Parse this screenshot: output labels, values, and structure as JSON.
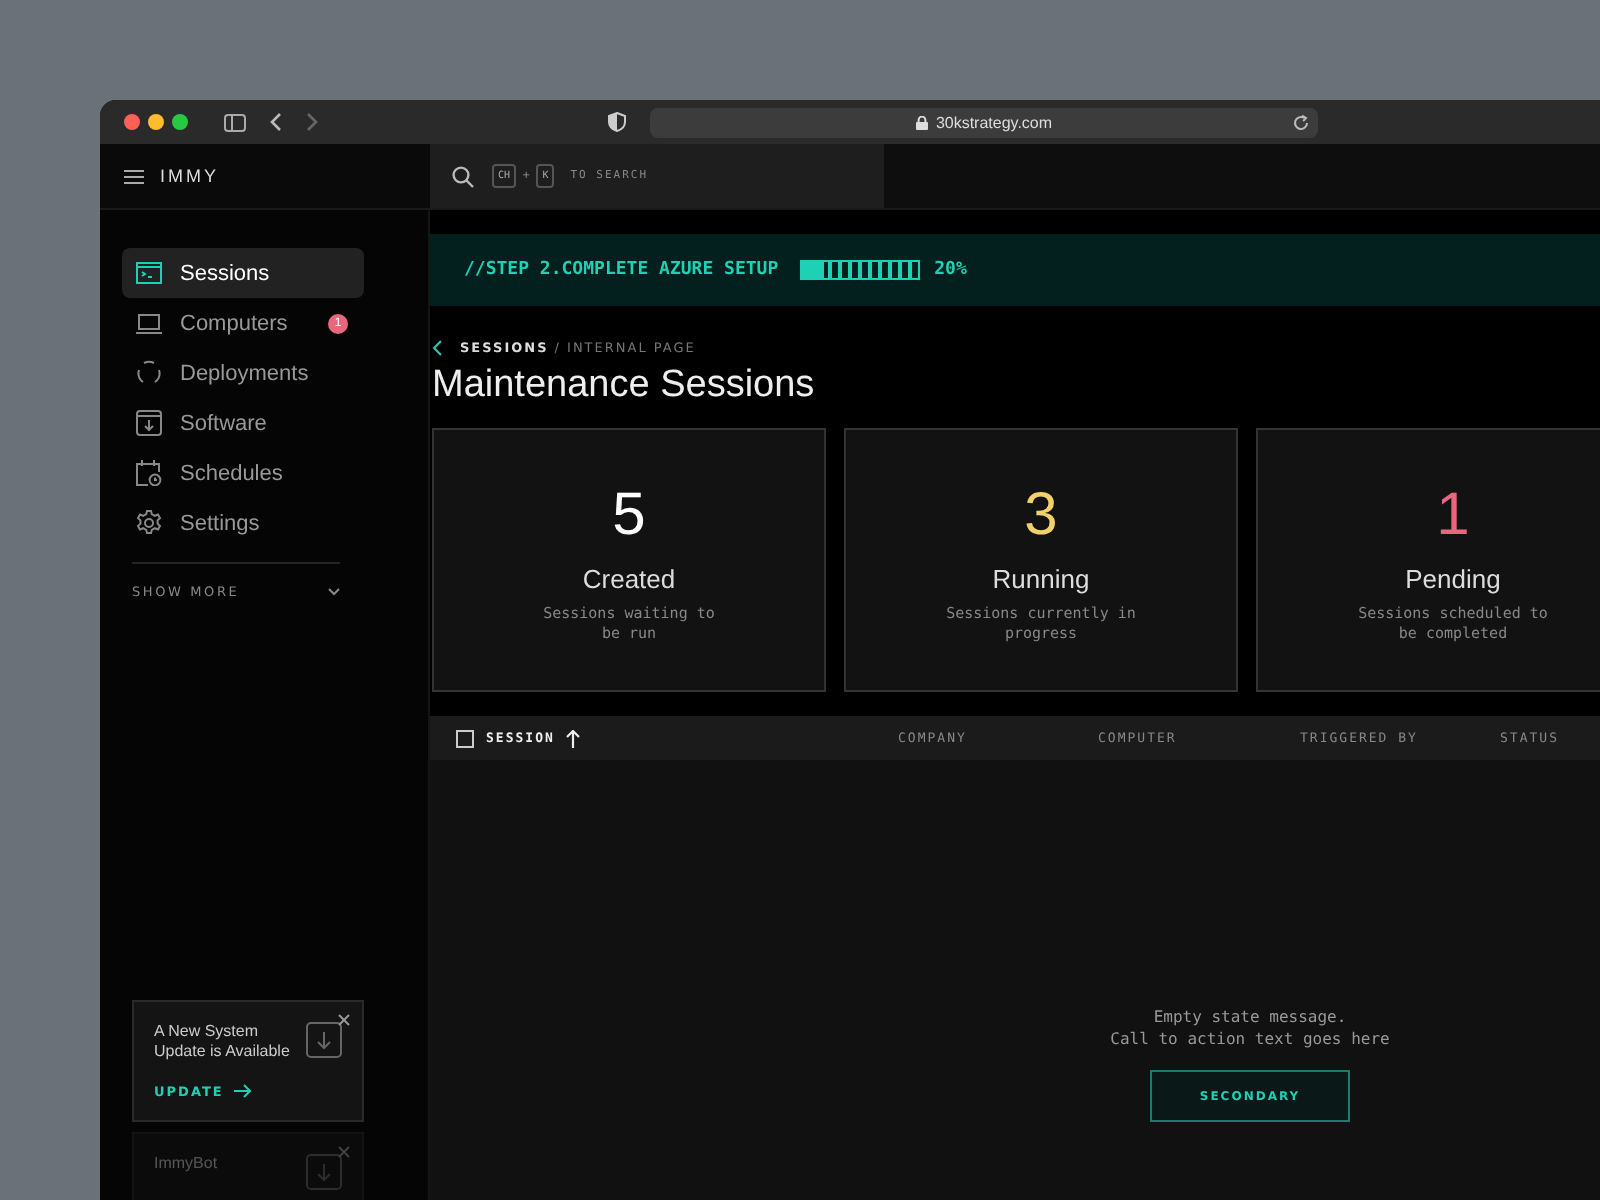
{
  "browser": {
    "url": "30kstrategy.com"
  },
  "app_bar": {
    "logo": "IMMY",
    "search_keys": [
      "CH",
      "K"
    ],
    "key_separator": "+",
    "search_hint": "TO SEARCH"
  },
  "sidebar": {
    "items": [
      {
        "label": "Sessions",
        "selected": true
      },
      {
        "label": "Computers",
        "selected": false,
        "badge": "1"
      },
      {
        "label": "Deployments",
        "selected": false
      },
      {
        "label": "Software",
        "selected": false
      },
      {
        "label": "Schedules",
        "selected": false
      },
      {
        "label": "Settings",
        "selected": false
      }
    ],
    "show_more": "SHOW MORE",
    "notices": [
      {
        "title": "A New System Update is Available",
        "action": "UPDATE"
      },
      {
        "title": "ImmyBot"
      }
    ]
  },
  "banner": {
    "text": "//STEP 2.COMPLETE AZURE SETUP",
    "level": 0.2,
    "percent": "20%"
  },
  "breadcrumb": {
    "current": "SESSIONS",
    "rest": "/ INTERNAL PAGE"
  },
  "title": "Maintenance Sessions",
  "stats": [
    {
      "value": "5",
      "label": "Created",
      "description": "Sessions waiting to be run",
      "color": "#ffffff"
    },
    {
      "value": "3",
      "label": "Running",
      "description": "Sessions currently in progress",
      "color": "#f2d06b"
    },
    {
      "value": "1",
      "label": "Pending",
      "description": "Sessions scheduled to be completed",
      "color": "#e8677f"
    }
  ],
  "table": {
    "select_all_checked": false,
    "columns": [
      {
        "label": "SESSION",
        "sorted": true
      },
      {
        "label": "COMPANY",
        "sorted": false
      },
      {
        "label": "COMPUTER",
        "sorted": false
      },
      {
        "label": "TRIGGERED BY",
        "sorted": false
      },
      {
        "label": "STATUS",
        "sorted": false
      }
    ],
    "empty": {
      "message": "Empty state message.",
      "hint": "Call to action text goes here",
      "button": "SECONDARY"
    }
  }
}
